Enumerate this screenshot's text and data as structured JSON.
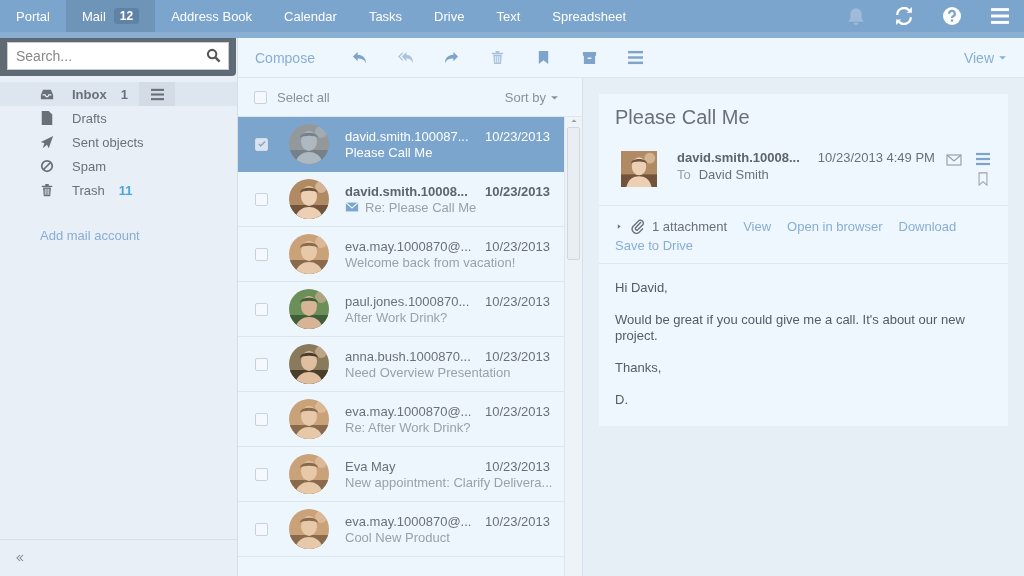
{
  "top_nav": {
    "tabs": [
      {
        "label": "Portal",
        "selected": false
      },
      {
        "label": "Mail",
        "selected": true,
        "badge": "12"
      },
      {
        "label": "Address Book",
        "selected": false
      },
      {
        "label": "Calendar",
        "selected": false
      },
      {
        "label": "Tasks",
        "selected": false
      },
      {
        "label": "Drive",
        "selected": false
      },
      {
        "label": "Text",
        "selected": false
      },
      {
        "label": "Spreadsheet",
        "selected": false
      }
    ]
  },
  "search": {
    "placeholder": "Search..."
  },
  "folders": [
    {
      "kind": "inbox",
      "label": "Inbox",
      "count": "1",
      "selected": true
    },
    {
      "kind": "drafts",
      "label": "Drafts",
      "selected": false
    },
    {
      "kind": "sent",
      "label": "Sent objects",
      "selected": false
    },
    {
      "kind": "spam",
      "label": "Spam",
      "selected": false
    },
    {
      "kind": "trash",
      "label": "Trash",
      "count": "11",
      "selected": false
    }
  ],
  "add_account": "Add mail account",
  "toolbar": {
    "compose": "Compose",
    "view": "View"
  },
  "list": {
    "select_all": {
      "label": "Select all",
      "checked": false
    },
    "sort": "Sort by",
    "messages": [
      {
        "sender": "david.smith.100087...",
        "date": "10/23/2013",
        "subject": "Please Call Me",
        "selected": true,
        "checked": true,
        "unread": false
      },
      {
        "sender": "david.smith.10008...",
        "date": "10/23/2013",
        "subject": "Re: Please Call Me",
        "selected": false,
        "checked": false,
        "unread": true
      },
      {
        "sender": "eva.may.1000870@...",
        "date": "10/23/2013",
        "subject": "Welcome back from vacation!",
        "selected": false,
        "checked": false,
        "unread": false
      },
      {
        "sender": "paul.jones.1000870...",
        "date": "10/23/2013",
        "subject": "After Work Drink?",
        "selected": false,
        "checked": false,
        "unread": false
      },
      {
        "sender": "anna.bush.1000870...",
        "date": "10/23/2013",
        "subject": "Need Overview Presentation",
        "selected": false,
        "checked": false,
        "unread": false
      },
      {
        "sender": "eva.may.1000870@...",
        "date": "10/23/2013",
        "subject": "Re: After Work Drink?",
        "selected": false,
        "checked": false,
        "unread": false
      },
      {
        "sender": "Eva May",
        "date": "10/23/2013",
        "subject": "New appointment: Clarify Delivera...",
        "selected": false,
        "checked": false,
        "unread": false
      },
      {
        "sender": "eva.may.1000870@...",
        "date": "10/23/2013",
        "subject": "Cool New Product",
        "selected": false,
        "checked": false,
        "unread": false
      }
    ]
  },
  "detail": {
    "subject": "Please Call Me",
    "from": "david.smith.10008...",
    "datetime": "10/23/2013 4:49 PM",
    "to_label": "To",
    "to": "David Smith",
    "attachment": {
      "label": "1 attachment",
      "links": [
        "View",
        "Open in browser",
        "Download",
        "Save to Drive"
      ]
    },
    "body": [
      "Hi David,",
      "Would be great if you could give me a call. It's about our new project.",
      "Thanks,",
      "D."
    ]
  }
}
